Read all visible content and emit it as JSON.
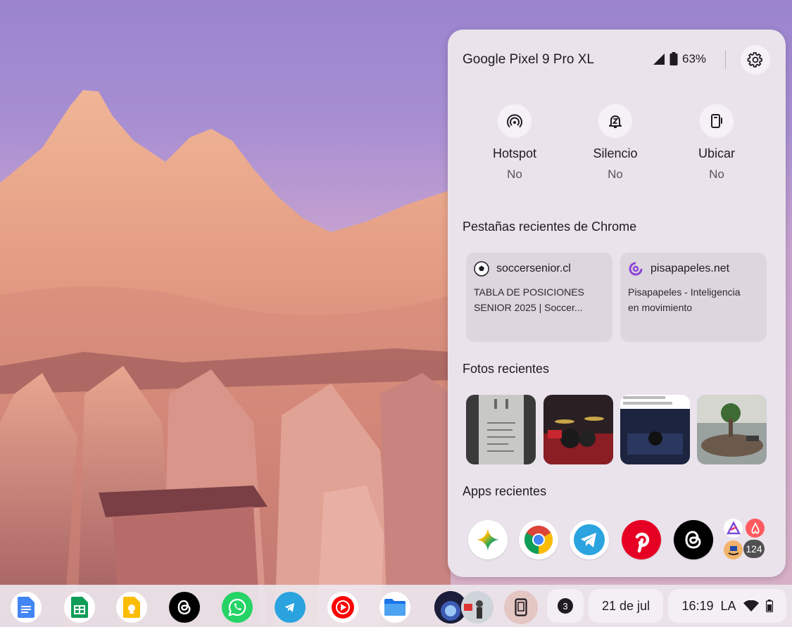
{
  "hub": {
    "device_name": "Google Pixel 9 Pro XL",
    "battery_percent": "63%",
    "settings_icon": "gear-icon",
    "toggles": [
      {
        "label": "Hotspot",
        "state": "No",
        "icon": "hotspot-icon"
      },
      {
        "label": "Silencio",
        "state": "No",
        "icon": "bell-snooze-icon"
      },
      {
        "label": "Ubicar",
        "state": "No",
        "icon": "phone-ring-icon"
      }
    ],
    "recent_tabs_title": "Pestañas recientes de Chrome",
    "tabs": [
      {
        "site": "soccersenior.cl",
        "title_line1": "TABLA DE POSICIONES",
        "title_line2": "SENIOR 2025 | Soccer..."
      },
      {
        "site": "pisapapeles.net",
        "title_line1": "Pisapapeles - Inteligencia",
        "title_line2": "en movimiento"
      }
    ],
    "recent_photos_title": "Fotos recientes",
    "recent_apps_title": "Apps recientes",
    "apps": [
      "gemini-icon",
      "chrome-icon",
      "telegram-icon",
      "pinterest-icon",
      "threads-icon"
    ],
    "more_apps_count": "124"
  },
  "shelf": {
    "apps": [
      "google-docs-icon",
      "google-sheets-icon",
      "google-keep-icon",
      "threads-icon",
      "whatsapp-icon",
      "telegram-icon",
      "youtube-music-icon",
      "files-icon"
    ],
    "notification_count": "3",
    "date": "21 de jul",
    "time": "16:19",
    "locale": "LA"
  }
}
